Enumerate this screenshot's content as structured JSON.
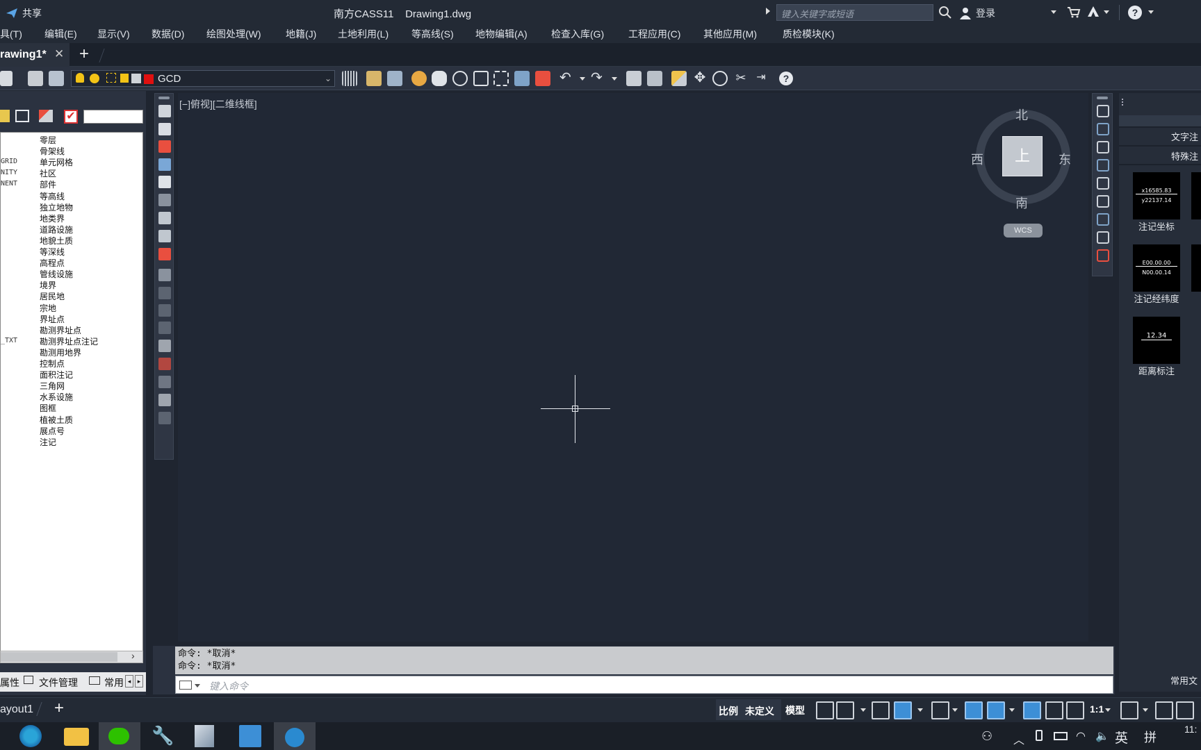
{
  "titlebar": {
    "share_label": "共享",
    "app_title": "南方CASS11",
    "file_name": "Drawing1.dwg",
    "search_placeholder": "键入关键字或短语",
    "login_label": "登录"
  },
  "menu": [
    "具(T)",
    "编辑(E)",
    "显示(V)",
    "数据(D)",
    "绘图处理(W)",
    "地籍(J)",
    "土地利用(L)",
    "等高线(S)",
    "地物编辑(A)",
    "检查入库(G)",
    "工程应用(C)",
    "其他应用(M)",
    "质检模块(K)"
  ],
  "tabs": {
    "active": "rawing1*",
    "add": "+"
  },
  "toolbar": {
    "layer_name": "GCD"
  },
  "layers": [
    {
      "code": "",
      "name": "零层"
    },
    {
      "code": "",
      "name": "骨架线"
    },
    {
      "code": "GRID",
      "name": "单元网格"
    },
    {
      "code": "NITY",
      "name": "社区"
    },
    {
      "code": "NENT",
      "name": "部件"
    },
    {
      "code": "",
      "name": "等高线"
    },
    {
      "code": "",
      "name": "独立地物"
    },
    {
      "code": "",
      "name": "地类界"
    },
    {
      "code": "",
      "name": "道路设施"
    },
    {
      "code": "",
      "name": "地貌土质"
    },
    {
      "code": "",
      "name": "等深线"
    },
    {
      "code": "",
      "name": "高程点"
    },
    {
      "code": "",
      "name": "管线设施"
    },
    {
      "code": "",
      "name": "境界"
    },
    {
      "code": "",
      "name": "居民地"
    },
    {
      "code": "",
      "name": "宗地"
    },
    {
      "code": "",
      "name": "界址点"
    },
    {
      "code": "",
      "name": "勘测界址点"
    },
    {
      "code": "_TXT",
      "name": "勘测界址点注记"
    },
    {
      "code": "",
      "name": "勘测用地界"
    },
    {
      "code": "",
      "name": "控制点"
    },
    {
      "code": "",
      "name": "面积注记"
    },
    {
      "code": "",
      "name": "三角网"
    },
    {
      "code": "",
      "name": "水系设施"
    },
    {
      "code": "",
      "name": "图框"
    },
    {
      "code": "",
      "name": "植被土质"
    },
    {
      "code": "",
      "name": "展点号"
    },
    {
      "code": "",
      "name": "注记"
    }
  ],
  "left_tabs": [
    "属性",
    "文件管理",
    "常用"
  ],
  "view_label": "[−]俯视][二维线框]",
  "compass": {
    "north": "北",
    "south": "南",
    "east": "东",
    "west": "西",
    "top": "上",
    "wcs": "WCS"
  },
  "command": {
    "line1": "命令: *取消*",
    "line2": "命令: *取消*",
    "input_placeholder": "键入命令"
  },
  "right_panel": {
    "tab1": "文字注",
    "tab2": "特殊注",
    "items": [
      {
        "thumb_line1": "x16585.83",
        "thumb_line2": "y22137.14",
        "label": "注记坐标"
      },
      {
        "thumb_line1": "E00.00.00",
        "thumb_line2": "N00.00.14",
        "label": "注记经纬度"
      },
      {
        "thumb_line1": "12.34",
        "thumb_line2": "",
        "label": "距离标注"
      }
    ],
    "bottom": "常用文"
  },
  "statusbar": {
    "layout": "ayout1",
    "scale_label": "比例",
    "scale_value": "未定义",
    "model": "模型",
    "ratio": "1:1"
  },
  "taskbar": {
    "lang": "英",
    "ime": "拼",
    "time": "11:"
  },
  "colors": {
    "accent": "#3d8fd6",
    "layer_swatch": "#e01010"
  }
}
